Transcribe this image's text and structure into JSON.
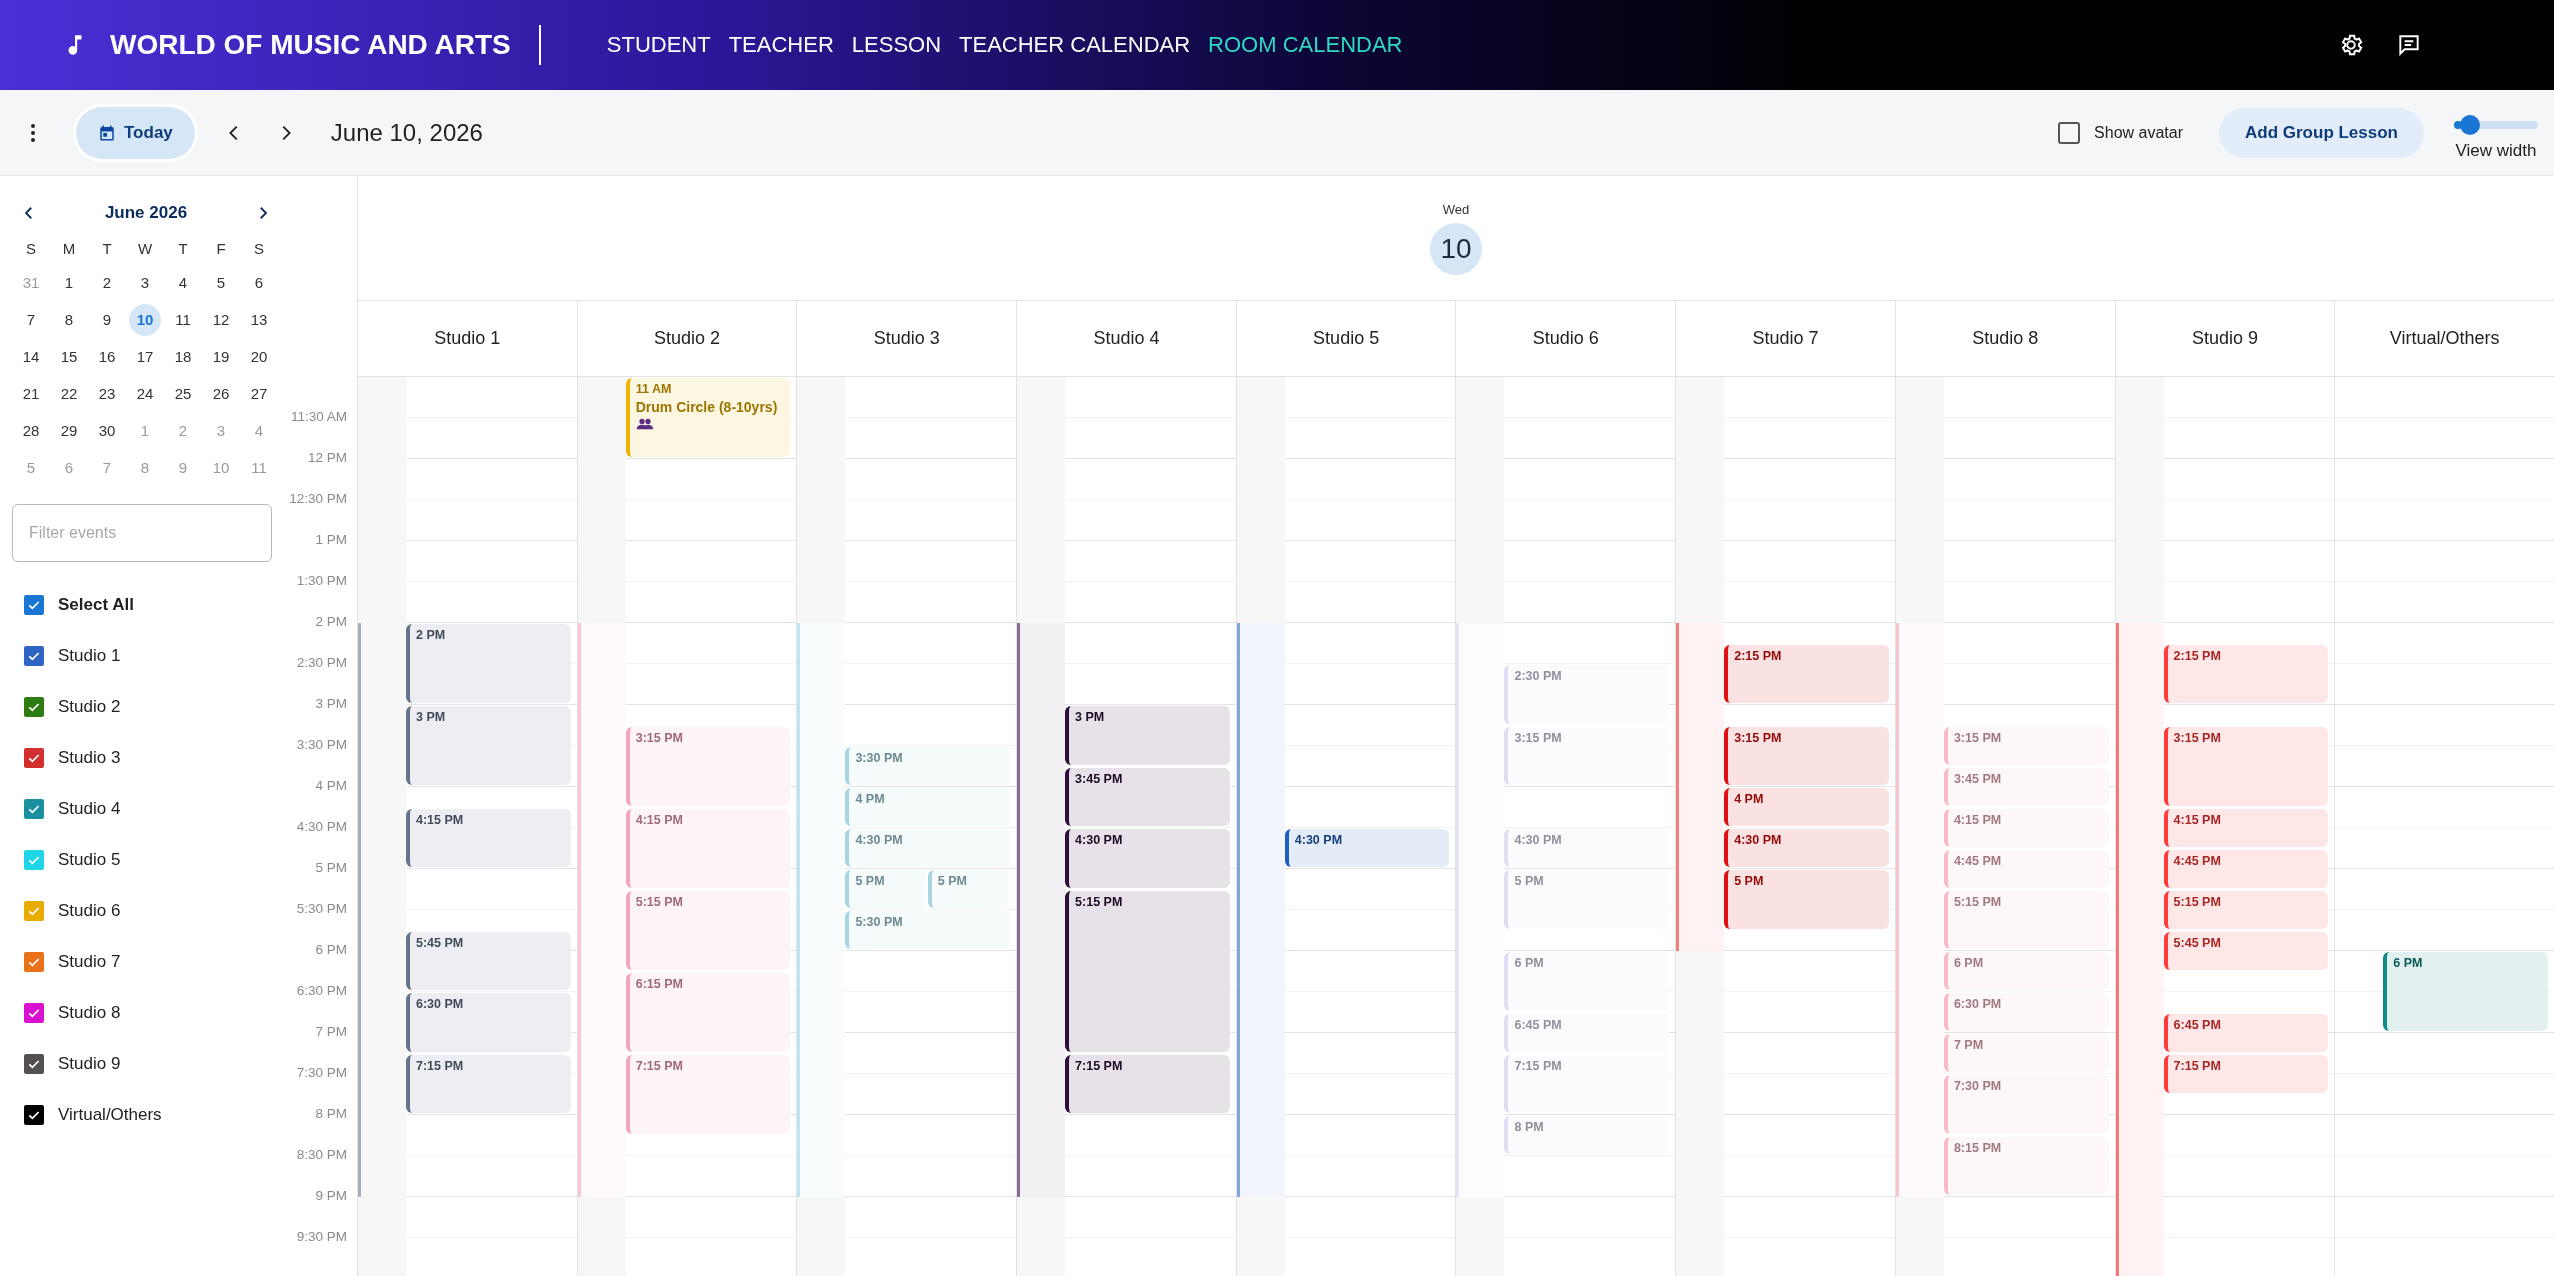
{
  "app": {
    "title": "WORLD OF MUSIC AND ARTS"
  },
  "nav": [
    {
      "label": "STUDENT",
      "selected": false
    },
    {
      "label": "TEACHER",
      "selected": false
    },
    {
      "label": "LESSON",
      "selected": false
    },
    {
      "label": "TEACHER CALENDAR",
      "selected": false
    },
    {
      "label": "ROOM CALENDAR",
      "selected": true
    }
  ],
  "toolbar": {
    "today": "Today",
    "date": "June 10, 2026",
    "show_avatar": {
      "label": "Show avatar",
      "checked": false
    },
    "add_button": "Add Group Lesson",
    "view_width": {
      "label": "View width",
      "level": 0.1
    }
  },
  "mini_calendar": {
    "title": "June 2026",
    "weekdays": [
      "S",
      "M",
      "T",
      "W",
      "T",
      "F",
      "S"
    ],
    "weeks": [
      [
        {
          "label": "31",
          "muted": true,
          "selected": false
        },
        {
          "label": "1",
          "muted": false,
          "selected": false
        },
        {
          "label": "2",
          "muted": false,
          "selected": false
        },
        {
          "label": "3",
          "muted": false,
          "selected": false
        },
        {
          "label": "4",
          "muted": false,
          "selected": false
        },
        {
          "label": "5",
          "muted": false,
          "selected": false
        },
        {
          "label": "6",
          "muted": false,
          "selected": false
        }
      ],
      [
        {
          "label": "7",
          "muted": false,
          "selected": false
        },
        {
          "label": "8",
          "muted": false,
          "selected": false
        },
        {
          "label": "9",
          "muted": false,
          "selected": false
        },
        {
          "label": "10",
          "muted": false,
          "selected": true
        },
        {
          "label": "11",
          "muted": false,
          "selected": false
        },
        {
          "label": "12",
          "muted": false,
          "selected": false
        },
        {
          "label": "13",
          "muted": false,
          "selected": false
        }
      ],
      [
        {
          "label": "14",
          "muted": false,
          "selected": false
        },
        {
          "label": "15",
          "muted": false,
          "selected": false
        },
        {
          "label": "16",
          "muted": false,
          "selected": false
        },
        {
          "label": "17",
          "muted": false,
          "selected": false
        },
        {
          "label": "18",
          "muted": false,
          "selected": false
        },
        {
          "label": "19",
          "muted": false,
          "selected": false
        },
        {
          "label": "20",
          "muted": false,
          "selected": false
        }
      ],
      [
        {
          "label": "21",
          "muted": false,
          "selected": false
        },
        {
          "label": "22",
          "muted": false,
          "selected": false
        },
        {
          "label": "23",
          "muted": false,
          "selected": false
        },
        {
          "label": "24",
          "muted": false,
          "selected": false
        },
        {
          "label": "25",
          "muted": false,
          "selected": false
        },
        {
          "label": "26",
          "muted": false,
          "selected": false
        },
        {
          "label": "27",
          "muted": false,
          "selected": false
        }
      ],
      [
        {
          "label": "28",
          "muted": false,
          "selected": false
        },
        {
          "label": "29",
          "muted": false,
          "selected": false
        },
        {
          "label": "30",
          "muted": false,
          "selected": false
        },
        {
          "label": "1",
          "muted": true,
          "selected": false
        },
        {
          "label": "2",
          "muted": true,
          "selected": false
        },
        {
          "label": "3",
          "muted": true,
          "selected": false
        },
        {
          "label": "4",
          "muted": true,
          "selected": false
        }
      ],
      [
        {
          "label": "5",
          "muted": true,
          "selected": false
        },
        {
          "label": "6",
          "muted": true,
          "selected": false
        },
        {
          "label": "7",
          "muted": true,
          "selected": false
        },
        {
          "label": "8",
          "muted": true,
          "selected": false
        },
        {
          "label": "9",
          "muted": true,
          "selected": false
        },
        {
          "label": "10",
          "muted": true,
          "selected": false
        },
        {
          "label": "11",
          "muted": true,
          "selected": false
        }
      ]
    ]
  },
  "filter": {
    "placeholder": "Filter events"
  },
  "filters": [
    {
      "label": "Select All",
      "checked": true,
      "color": "#1976d2",
      "bold": true
    },
    {
      "label": "Studio 1",
      "checked": true,
      "color": "#2f63c4",
      "bold": false
    },
    {
      "label": "Studio 2",
      "checked": true,
      "color": "#2e7d12",
      "bold": false
    },
    {
      "label": "Studio 3",
      "checked": true,
      "color": "#d32f2f",
      "bold": false
    },
    {
      "label": "Studio 4",
      "checked": true,
      "color": "#1a8fa0",
      "bold": false
    },
    {
      "label": "Studio 5",
      "checked": true,
      "color": "#1ed6e8",
      "bold": false
    },
    {
      "label": "Studio 6",
      "checked": true,
      "color": "#e8ab00",
      "bold": false
    },
    {
      "label": "Studio 7",
      "checked": true,
      "color": "#e8711a",
      "bold": false
    },
    {
      "label": "Studio 8",
      "checked": true,
      "color": "#d910cf",
      "bold": false
    },
    {
      "label": "Studio 9",
      "checked": true,
      "color": "#555050",
      "bold": false
    },
    {
      "label": "Virtual/Others",
      "checked": true,
      "color": "#000000",
      "bold": false
    }
  ],
  "day": {
    "weekday": "Wed",
    "date": "10"
  },
  "time_labels": [
    "11:30 AM",
    "12 PM",
    "12:30 PM",
    "1 PM",
    "1:30 PM",
    "2 PM",
    "2:30 PM",
    "3 PM",
    "3:30 PM",
    "4 PM",
    "4:30 PM",
    "5 PM",
    "5:30 PM",
    "6 PM",
    "6:30 PM",
    "7 PM",
    "7:30 PM",
    "8 PM",
    "8:30 PM",
    "9 PM",
    "9:30 PM"
  ],
  "columns": [
    {
      "name": "Studio 1",
      "color": "#aab0ba",
      "gutter": [
        {
          "open": false
        },
        {
          "open": false
        },
        {
          "open": false
        },
        {
          "open": true
        },
        {
          "open": true
        },
        {
          "open": true
        },
        {
          "open": true
        },
        {
          "open": true
        },
        {
          "open": true
        },
        {
          "open": true
        },
        {
          "open": false
        }
      ],
      "slots": [
        {
          "kind": "free"
        },
        {
          "kind": "free"
        },
        {
          "kind": "free"
        },
        {
          "kind": "free"
        },
        {
          "kind": "free"
        },
        {
          "kind": "free"
        },
        {
          "kind": "free"
        },
        {
          "kind": "free"
        },
        {
          "kind": "free"
        },
        {
          "kind": "free"
        },
        {
          "kind": "free"
        },
        {
          "kind": "free"
        },
        {
          "kind": "event",
          "time": "2 PM",
          "color": "#64748b",
          "group": false
        },
        {
          "kind": "more"
        },
        {
          "kind": "more"
        },
        {
          "kind": "more"
        },
        {
          "kind": "event",
          "time": "3 PM",
          "color": "#64748b",
          "group": false
        },
        {
          "kind": "more"
        },
        {
          "kind": "more"
        },
        {
          "kind": "more"
        },
        {
          "kind": "free"
        },
        {
          "kind": "event",
          "time": "4:15 PM",
          "color": "#64748b",
          "group": false
        },
        {
          "kind": "more"
        },
        {
          "kind": "more"
        },
        {
          "kind": "free"
        },
        {
          "kind": "free"
        },
        {
          "kind": "free"
        },
        {
          "kind": "event",
          "time": "5:45 PM",
          "color": "#64748b",
          "group": false
        },
        {
          "kind": "more"
        },
        {
          "kind": "more"
        },
        {
          "kind": "event",
          "time": "6:30 PM",
          "color": "#64748b",
          "group": false
        },
        {
          "kind": "more"
        },
        {
          "kind": "more"
        },
        {
          "kind": "event",
          "time": "7:15 PM",
          "color": "#64748b",
          "group": false
        },
        {
          "kind": "more"
        },
        {
          "kind": "more"
        }
      ]
    },
    {
      "name": "Studio 2",
      "color": "#f9c6d6",
      "gutter": [
        {
          "open": false
        },
        {
          "open": false
        },
        {
          "open": false
        },
        {
          "open": true
        },
        {
          "open": true
        },
        {
          "open": true
        },
        {
          "open": true
        },
        {
          "open": true
        },
        {
          "open": true
        },
        {
          "open": true
        },
        {
          "open": false
        }
      ],
      "slots": [
        {
          "kind": "event",
          "time": "11 AM",
          "title": "Drum Circle (8-10yrs)",
          "color": "#f2b200",
          "group": true
        },
        {
          "kind": "more"
        },
        {
          "kind": "more"
        },
        {
          "kind": "more"
        },
        {
          "kind": "free"
        },
        {
          "kind": "free"
        },
        {
          "kind": "free"
        },
        {
          "kind": "free"
        },
        {
          "kind": "free"
        },
        {
          "kind": "free"
        },
        {
          "kind": "free"
        },
        {
          "kind": "free"
        },
        {
          "kind": "free"
        },
        {
          "kind": "free"
        },
        {
          "kind": "free"
        },
        {
          "kind": "free"
        },
        {
          "kind": "free"
        },
        {
          "kind": "event",
          "time": "3:15 PM",
          "color": "#f4a3c0",
          "group": false
        },
        {
          "kind": "more"
        },
        {
          "kind": "more"
        },
        {
          "kind": "more"
        },
        {
          "kind": "event",
          "time": "4:15 PM",
          "color": "#f4a3c0",
          "group": false
        },
        {
          "kind": "more"
        },
        {
          "kind": "more"
        },
        {
          "kind": "more"
        },
        {
          "kind": "event",
          "time": "5:15 PM",
          "color": "#f4a3c0",
          "group": false
        },
        {
          "kind": "more"
        },
        {
          "kind": "more"
        },
        {
          "kind": "more"
        },
        {
          "kind": "event",
          "time": "6:15 PM",
          "color": "#f4a3c0",
          "group": false
        },
        {
          "kind": "more"
        },
        {
          "kind": "more"
        },
        {
          "kind": "more"
        },
        {
          "kind": "event",
          "time": "7:15 PM",
          "color": "#f4a3c0",
          "group": false
        },
        {
          "kind": "more"
        },
        {
          "kind": "more"
        },
        {
          "kind": "more"
        }
      ]
    },
    {
      "name": "Studio 3",
      "color": "#bfe3ef",
      "gutter": [
        {
          "open": false
        },
        {
          "open": false
        },
        {
          "open": false
        },
        {
          "open": true
        },
        {
          "open": true
        },
        {
          "open": true
        },
        {
          "open": true
        },
        {
          "open": true
        },
        {
          "open": true
        },
        {
          "open": true
        },
        {
          "open": false
        }
      ],
      "slots": [
        {
          "kind": "free"
        },
        {
          "kind": "free"
        },
        {
          "kind": "free"
        },
        {
          "kind": "free"
        },
        {
          "kind": "free"
        },
        {
          "kind": "free"
        },
        {
          "kind": "free"
        },
        {
          "kind": "free"
        },
        {
          "kind": "free"
        },
        {
          "kind": "free"
        },
        {
          "kind": "free"
        },
        {
          "kind": "free"
        },
        {
          "kind": "free"
        },
        {
          "kind": "free"
        },
        {
          "kind": "free"
        },
        {
          "kind": "free"
        },
        {
          "kind": "free"
        },
        {
          "kind": "free"
        },
        {
          "kind": "event",
          "time": "3:30 PM",
          "color": "#a8d4e0",
          "group": false
        },
        {
          "kind": "more"
        },
        {
          "kind": "event",
          "time": "4 PM",
          "color": "#a8d4e0",
          "group": false
        },
        {
          "kind": "more"
        },
        {
          "kind": "event",
          "time": "4:30 PM",
          "color": "#a8d4e0",
          "group": false
        },
        {
          "kind": "more"
        },
        {
          "kind": "pair",
          "events": [
            {
              "time": "5 PM",
              "color": "#a8d4e0",
              "group": false
            },
            {
              "time": "5 PM",
              "color": "#a8d4e0",
              "group": false
            }
          ]
        },
        {
          "kind": "more"
        },
        {
          "kind": "event",
          "time": "5:30 PM",
          "color": "#a8d4e0",
          "group": false
        },
        {
          "kind": "more"
        }
      ]
    },
    {
      "name": "Studio 4",
      "color": "#8a6a94",
      "gutter": [
        {
          "open": false
        },
        {
          "open": false
        },
        {
          "open": false
        },
        {
          "open": true
        },
        {
          "open": true
        },
        {
          "open": true
        },
        {
          "open": true
        },
        {
          "open": true
        },
        {
          "open": true
        },
        {
          "open": true
        },
        {
          "open": false
        }
      ],
      "slots": [
        {
          "kind": "free"
        },
        {
          "kind": "free"
        },
        {
          "kind": "free"
        },
        {
          "kind": "free"
        },
        {
          "kind": "free"
        },
        {
          "kind": "free"
        },
        {
          "kind": "free"
        },
        {
          "kind": "free"
        },
        {
          "kind": "free"
        },
        {
          "kind": "free"
        },
        {
          "kind": "free"
        },
        {
          "kind": "free"
        },
        {
          "kind": "free"
        },
        {
          "kind": "free"
        },
        {
          "kind": "free"
        },
        {
          "kind": "free"
        },
        {
          "kind": "event",
          "time": "3 PM",
          "color": "#2e0f3a",
          "group": false
        },
        {
          "kind": "more"
        },
        {
          "kind": "more"
        },
        {
          "kind": "event",
          "time": "3:45 PM",
          "color": "#2e0f3a",
          "group": false
        },
        {
          "kind": "more"
        },
        {
          "kind": "more"
        },
        {
          "kind": "event",
          "time": "4:30 PM",
          "color": "#2e0f3a",
          "group": false
        },
        {
          "kind": "more"
        },
        {
          "kind": "more"
        },
        {
          "kind": "event",
          "time": "5:15 PM",
          "color": "#2e0f3a",
          "group": false
        },
        {
          "kind": "more"
        },
        {
          "kind": "more"
        },
        {
          "kind": "more"
        },
        {
          "kind": "more"
        },
        {
          "kind": "more"
        },
        {
          "kind": "more"
        },
        {
          "kind": "more"
        },
        {
          "kind": "event",
          "time": "7:15 PM",
          "color": "#2e0f3a",
          "group": false
        },
        {
          "kind": "more"
        },
        {
          "kind": "more"
        }
      ]
    },
    {
      "name": "Studio 5",
      "color": "#7ea6dc",
      "gutter": [
        {
          "open": false
        },
        {
          "open": false
        },
        {
          "open": false
        },
        {
          "open": true
        },
        {
          "open": true
        },
        {
          "open": true
        },
        {
          "open": true
        },
        {
          "open": true
        },
        {
          "open": true
        },
        {
          "open": true
        },
        {
          "open": false
        }
      ],
      "slots": [
        {
          "kind": "free"
        },
        {
          "kind": "free"
        },
        {
          "kind": "free"
        },
        {
          "kind": "free"
        },
        {
          "kind": "free"
        },
        {
          "kind": "free"
        },
        {
          "kind": "free"
        },
        {
          "kind": "free"
        },
        {
          "kind": "free"
        },
        {
          "kind": "free"
        },
        {
          "kind": "free"
        },
        {
          "kind": "free"
        },
        {
          "kind": "free"
        },
        {
          "kind": "free"
        },
        {
          "kind": "free"
        },
        {
          "kind": "free"
        },
        {
          "kind": "free"
        },
        {
          "kind": "free"
        },
        {
          "kind": "free"
        },
        {
          "kind": "free"
        },
        {
          "kind": "free"
        },
        {
          "kind": "free"
        },
        {
          "kind": "event",
          "time": "4:30 PM",
          "color": "#1e5fbf",
          "group": false
        },
        {
          "kind": "more"
        }
      ]
    },
    {
      "name": "Studio 6",
      "color": "#e6e3f4",
      "gutter": [
        {
          "open": false
        },
        {
          "open": false
        },
        {
          "open": false
        },
        {
          "open": true
        },
        {
          "open": true
        },
        {
          "open": true
        },
        {
          "open": true
        },
        {
          "open": true
        },
        {
          "open": true
        },
        {
          "open": true
        },
        {
          "open": false
        }
      ],
      "slots": [
        {
          "kind": "free"
        },
        {
          "kind": "free"
        },
        {
          "kind": "free"
        },
        {
          "kind": "free"
        },
        {
          "kind": "free"
        },
        {
          "kind": "free"
        },
        {
          "kind": "free"
        },
        {
          "kind": "free"
        },
        {
          "kind": "free"
        },
        {
          "kind": "free"
        },
        {
          "kind": "free"
        },
        {
          "kind": "free"
        },
        {
          "kind": "free"
        },
        {
          "kind": "free"
        },
        {
          "kind": "event",
          "time": "2:30 PM",
          "color": "#e0ddf2",
          "group": false
        },
        {
          "kind": "more"
        },
        {
          "kind": "more"
        },
        {
          "kind": "event",
          "time": "3:15 PM",
          "color": "#e0ddf2",
          "group": false
        },
        {
          "kind": "more"
        },
        {
          "kind": "more"
        },
        {
          "kind": "free"
        },
        {
          "kind": "free"
        },
        {
          "kind": "event",
          "time": "4:30 PM",
          "color": "#e0ddf2",
          "group": false
        },
        {
          "kind": "more"
        },
        {
          "kind": "event",
          "time": "5 PM",
          "color": "#e0ddf2",
          "group": false
        },
        {
          "kind": "more"
        },
        {
          "kind": "more"
        },
        {
          "kind": "free"
        },
        {
          "kind": "event",
          "time": "6 PM",
          "color": "#e0ddf2",
          "group": false
        },
        {
          "kind": "more"
        },
        {
          "kind": "more"
        },
        {
          "kind": "event",
          "time": "6:45 PM",
          "color": "#e0ddf2",
          "group": false
        },
        {
          "kind": "more"
        },
        {
          "kind": "event",
          "time": "7:15 PM",
          "color": "#e0ddf2",
          "group": false
        },
        {
          "kind": "more"
        },
        {
          "kind": "more"
        },
        {
          "kind": "event",
          "time": "8 PM",
          "color": "#e0ddf2",
          "group": false
        },
        {
          "kind": "more"
        }
      ]
    },
    {
      "name": "Studio 7",
      "color": "#f08080",
      "gutter": [
        {
          "open": false
        },
        {
          "open": false
        },
        {
          "open": false
        },
        {
          "open": true
        },
        {
          "open": true
        },
        {
          "open": true
        },
        {
          "open": true
        },
        {
          "open": false
        },
        {
          "open": false
        },
        {
          "open": false
        },
        {
          "open": false
        }
      ],
      "slots": [
        {
          "kind": "free"
        },
        {
          "kind": "free"
        },
        {
          "kind": "free"
        },
        {
          "kind": "free"
        },
        {
          "kind": "free"
        },
        {
          "kind": "free"
        },
        {
          "kind": "free"
        },
        {
          "kind": "free"
        },
        {
          "kind": "free"
        },
        {
          "kind": "free"
        },
        {
          "kind": "free"
        },
        {
          "kind": "free"
        },
        {
          "kind": "free"
        },
        {
          "kind": "event",
          "time": "2:15 PM",
          "color": "#e01010",
          "group": false
        },
        {
          "kind": "more"
        },
        {
          "kind": "more"
        },
        {
          "kind": "free"
        },
        {
          "kind": "event",
          "time": "3:15 PM",
          "color": "#e01010",
          "group": false
        },
        {
          "kind": "more"
        },
        {
          "kind": "more"
        },
        {
          "kind": "event",
          "time": "4 PM",
          "color": "#e01010",
          "group": false
        },
        {
          "kind": "more"
        },
        {
          "kind": "event",
          "time": "4:30 PM",
          "color": "#e01010",
          "group": false
        },
        {
          "kind": "more"
        },
        {
          "kind": "event",
          "time": "5 PM",
          "color": "#e01010",
          "group": false
        },
        {
          "kind": "more"
        },
        {
          "kind": "more"
        }
      ]
    },
    {
      "name": "Studio 8",
      "color": "#f7c5cc",
      "gutter": [
        {
          "open": false
        },
        {
          "open": false
        },
        {
          "open": false
        },
        {
          "open": true
        },
        {
          "open": true
        },
        {
          "open": true
        },
        {
          "open": true
        },
        {
          "open": true
        },
        {
          "open": true
        },
        {
          "open": true
        },
        {
          "open": false
        }
      ],
      "slots": [
        {
          "kind": "free"
        },
        {
          "kind": "free"
        },
        {
          "kind": "free"
        },
        {
          "kind": "free"
        },
        {
          "kind": "free"
        },
        {
          "kind": "free"
        },
        {
          "kind": "free"
        },
        {
          "kind": "free"
        },
        {
          "kind": "free"
        },
        {
          "kind": "free"
        },
        {
          "kind": "free"
        },
        {
          "kind": "free"
        },
        {
          "kind": "free"
        },
        {
          "kind": "free"
        },
        {
          "kind": "free"
        },
        {
          "kind": "free"
        },
        {
          "kind": "free"
        },
        {
          "kind": "event",
          "time": "3:15 PM",
          "color": "#f8bac6",
          "group": false
        },
        {
          "kind": "more"
        },
        {
          "kind": "event",
          "time": "3:45 PM",
          "color": "#f8bac6",
          "group": false
        },
        {
          "kind": "more"
        },
        {
          "kind": "event",
          "time": "4:15 PM",
          "color": "#f8bac6",
          "group": false
        },
        {
          "kind": "more"
        },
        {
          "kind": "event",
          "time": "4:45 PM",
          "color": "#f8bac6",
          "group": false
        },
        {
          "kind": "more"
        },
        {
          "kind": "event",
          "time": "5:15 PM",
          "color": "#f8bac6",
          "group": false
        },
        {
          "kind": "more"
        },
        {
          "kind": "more"
        },
        {
          "kind": "event",
          "time": "6 PM",
          "color": "#f8bac6",
          "group": false
        },
        {
          "kind": "more"
        },
        {
          "kind": "event",
          "time": "6:30 PM",
          "color": "#f8bac6",
          "group": false
        },
        {
          "kind": "more"
        },
        {
          "kind": "event",
          "time": "7 PM",
          "color": "#f8bac6",
          "group": false
        },
        {
          "kind": "more"
        },
        {
          "kind": "event",
          "time": "7:30 PM",
          "color": "#f8bac6",
          "group": false
        },
        {
          "kind": "more"
        },
        {
          "kind": "more"
        },
        {
          "kind": "event",
          "time": "8:15 PM",
          "color": "#f8bac6",
          "group": false
        },
        {
          "kind": "more"
        },
        {
          "kind": "more"
        }
      ]
    },
    {
      "name": "Studio 9",
      "color": "#f07878",
      "gutter": [
        {
          "open": false
        },
        {
          "open": false
        },
        {
          "open": false
        },
        {
          "open": true
        },
        {
          "open": true
        },
        {
          "open": true
        },
        {
          "open": true
        },
        {
          "open": true
        },
        {
          "open": true
        },
        {
          "open": true
        },
        {
          "open": true
        }
      ],
      "slots": [
        {
          "kind": "free"
        },
        {
          "kind": "free"
        },
        {
          "kind": "free"
        },
        {
          "kind": "free"
        },
        {
          "kind": "free"
        },
        {
          "kind": "free"
        },
        {
          "kind": "free"
        },
        {
          "kind": "free"
        },
        {
          "kind": "free"
        },
        {
          "kind": "free"
        },
        {
          "kind": "free"
        },
        {
          "kind": "free"
        },
        {
          "kind": "free"
        },
        {
          "kind": "event",
          "time": "2:15 PM",
          "color": "#ff3b3b",
          "group": false
        },
        {
          "kind": "more"
        },
        {
          "kind": "more"
        },
        {
          "kind": "free"
        },
        {
          "kind": "event",
          "time": "3:15 PM",
          "color": "#ff3b3b",
          "group": false
        },
        {
          "kind": "more"
        },
        {
          "kind": "more"
        },
        {
          "kind": "more"
        },
        {
          "kind": "event",
          "time": "4:15 PM",
          "color": "#ff3b3b",
          "group": false
        },
        {
          "kind": "more"
        },
        {
          "kind": "event",
          "time": "4:45 PM",
          "color": "#ff3b3b",
          "group": false
        },
        {
          "kind": "more"
        },
        {
          "kind": "event",
          "time": "5:15 PM",
          "color": "#ff3b3b",
          "group": false
        },
        {
          "kind": "more"
        },
        {
          "kind": "event",
          "time": "5:45 PM",
          "color": "#ff3b3b",
          "group": false
        },
        {
          "kind": "more"
        },
        {
          "kind": "free"
        },
        {
          "kind": "free"
        },
        {
          "kind": "event",
          "time": "6:45 PM",
          "color": "#ff3b3b",
          "group": false
        },
        {
          "kind": "more"
        },
        {
          "kind": "event",
          "time": "7:15 PM",
          "color": "#ff3b3b",
          "group": false
        },
        {
          "kind": "more"
        }
      ]
    },
    {
      "name": "Virtual/Others",
      "slots": [
        {
          "kind": "free"
        },
        {
          "kind": "free"
        },
        {
          "kind": "free"
        },
        {
          "kind": "free"
        },
        {
          "kind": "free"
        },
        {
          "kind": "free"
        },
        {
          "kind": "free"
        },
        {
          "kind": "free"
        },
        {
          "kind": "free"
        },
        {
          "kind": "free"
        },
        {
          "kind": "free"
        },
        {
          "kind": "free"
        },
        {
          "kind": "free"
        },
        {
          "kind": "free"
        },
        {
          "kind": "free"
        },
        {
          "kind": "free"
        },
        {
          "kind": "free"
        },
        {
          "kind": "free"
        },
        {
          "kind": "free"
        },
        {
          "kind": "free"
        },
        {
          "kind": "free"
        },
        {
          "kind": "free"
        },
        {
          "kind": "free"
        },
        {
          "kind": "free"
        },
        {
          "kind": "free"
        },
        {
          "kind": "free"
        },
        {
          "kind": "free"
        },
        {
          "kind": "free"
        },
        {
          "kind": "event",
          "time": "6 PM",
          "color": "#0f8a85",
          "group": false
        },
        {
          "kind": "more"
        },
        {
          "kind": "more"
        },
        {
          "kind": "more"
        }
      ]
    }
  ]
}
